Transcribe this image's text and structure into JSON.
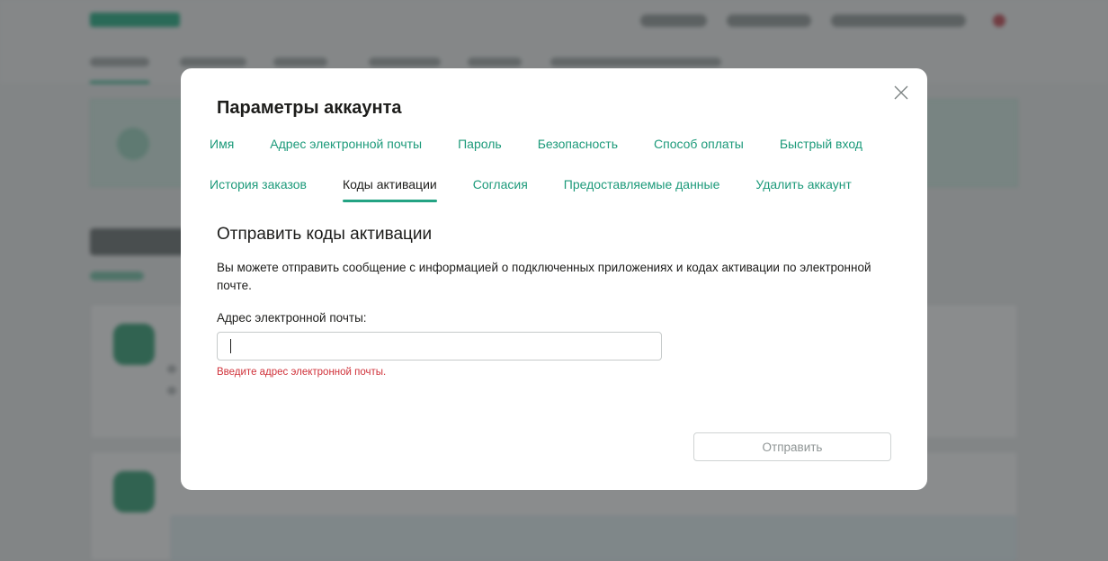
{
  "modal": {
    "title": "Параметры аккаунта",
    "tabs_row1": [
      {
        "label": "Имя"
      },
      {
        "label": "Адрес электронной почты"
      },
      {
        "label": "Пароль"
      },
      {
        "label": "Безопасность"
      },
      {
        "label": "Способ оплаты"
      },
      {
        "label": "Быстрый вход"
      }
    ],
    "tabs_row2": [
      {
        "label": "История заказов"
      },
      {
        "label": "Коды активации",
        "active": true
      },
      {
        "label": "Согласия"
      },
      {
        "label": "Предоставляемые данные"
      },
      {
        "label": "Удалить аккаунт"
      }
    ],
    "section_title": "Отправить коды активации",
    "description": "Вы можете отправить сообщение с информацией о подключенных приложениях и кодах активации по электронной почте.",
    "email_label": "Адрес электронной почты:",
    "email_value": "",
    "error": "Введите адрес электронной почты.",
    "submit_label": "Отправить",
    "icons": {
      "close": "close-icon"
    }
  },
  "colors": {
    "accent": "#1c9a7a",
    "tab_underline": "#23a383",
    "error": "#d0323a",
    "overlay": "rgba(42,46,48,0.55)"
  }
}
